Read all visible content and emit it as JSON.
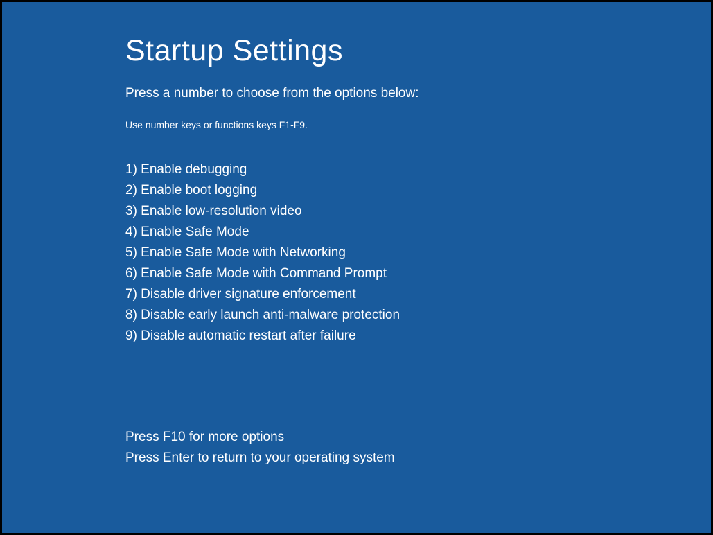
{
  "title": "Startup Settings",
  "subtitle": "Press a number to choose from the options below:",
  "hint": "Use number keys or functions keys F1-F9.",
  "options": [
    "1) Enable debugging",
    "2) Enable boot logging",
    "3) Enable low-resolution video",
    "4) Enable Safe Mode",
    "5) Enable Safe Mode with Networking",
    "6) Enable Safe Mode with Command Prompt",
    "7) Disable driver signature enforcement",
    "8) Disable early launch anti-malware protection",
    "9) Disable automatic restart after failure"
  ],
  "footer": {
    "more_options": "Press F10 for more options",
    "return_os": "Press Enter to return to your operating system"
  }
}
